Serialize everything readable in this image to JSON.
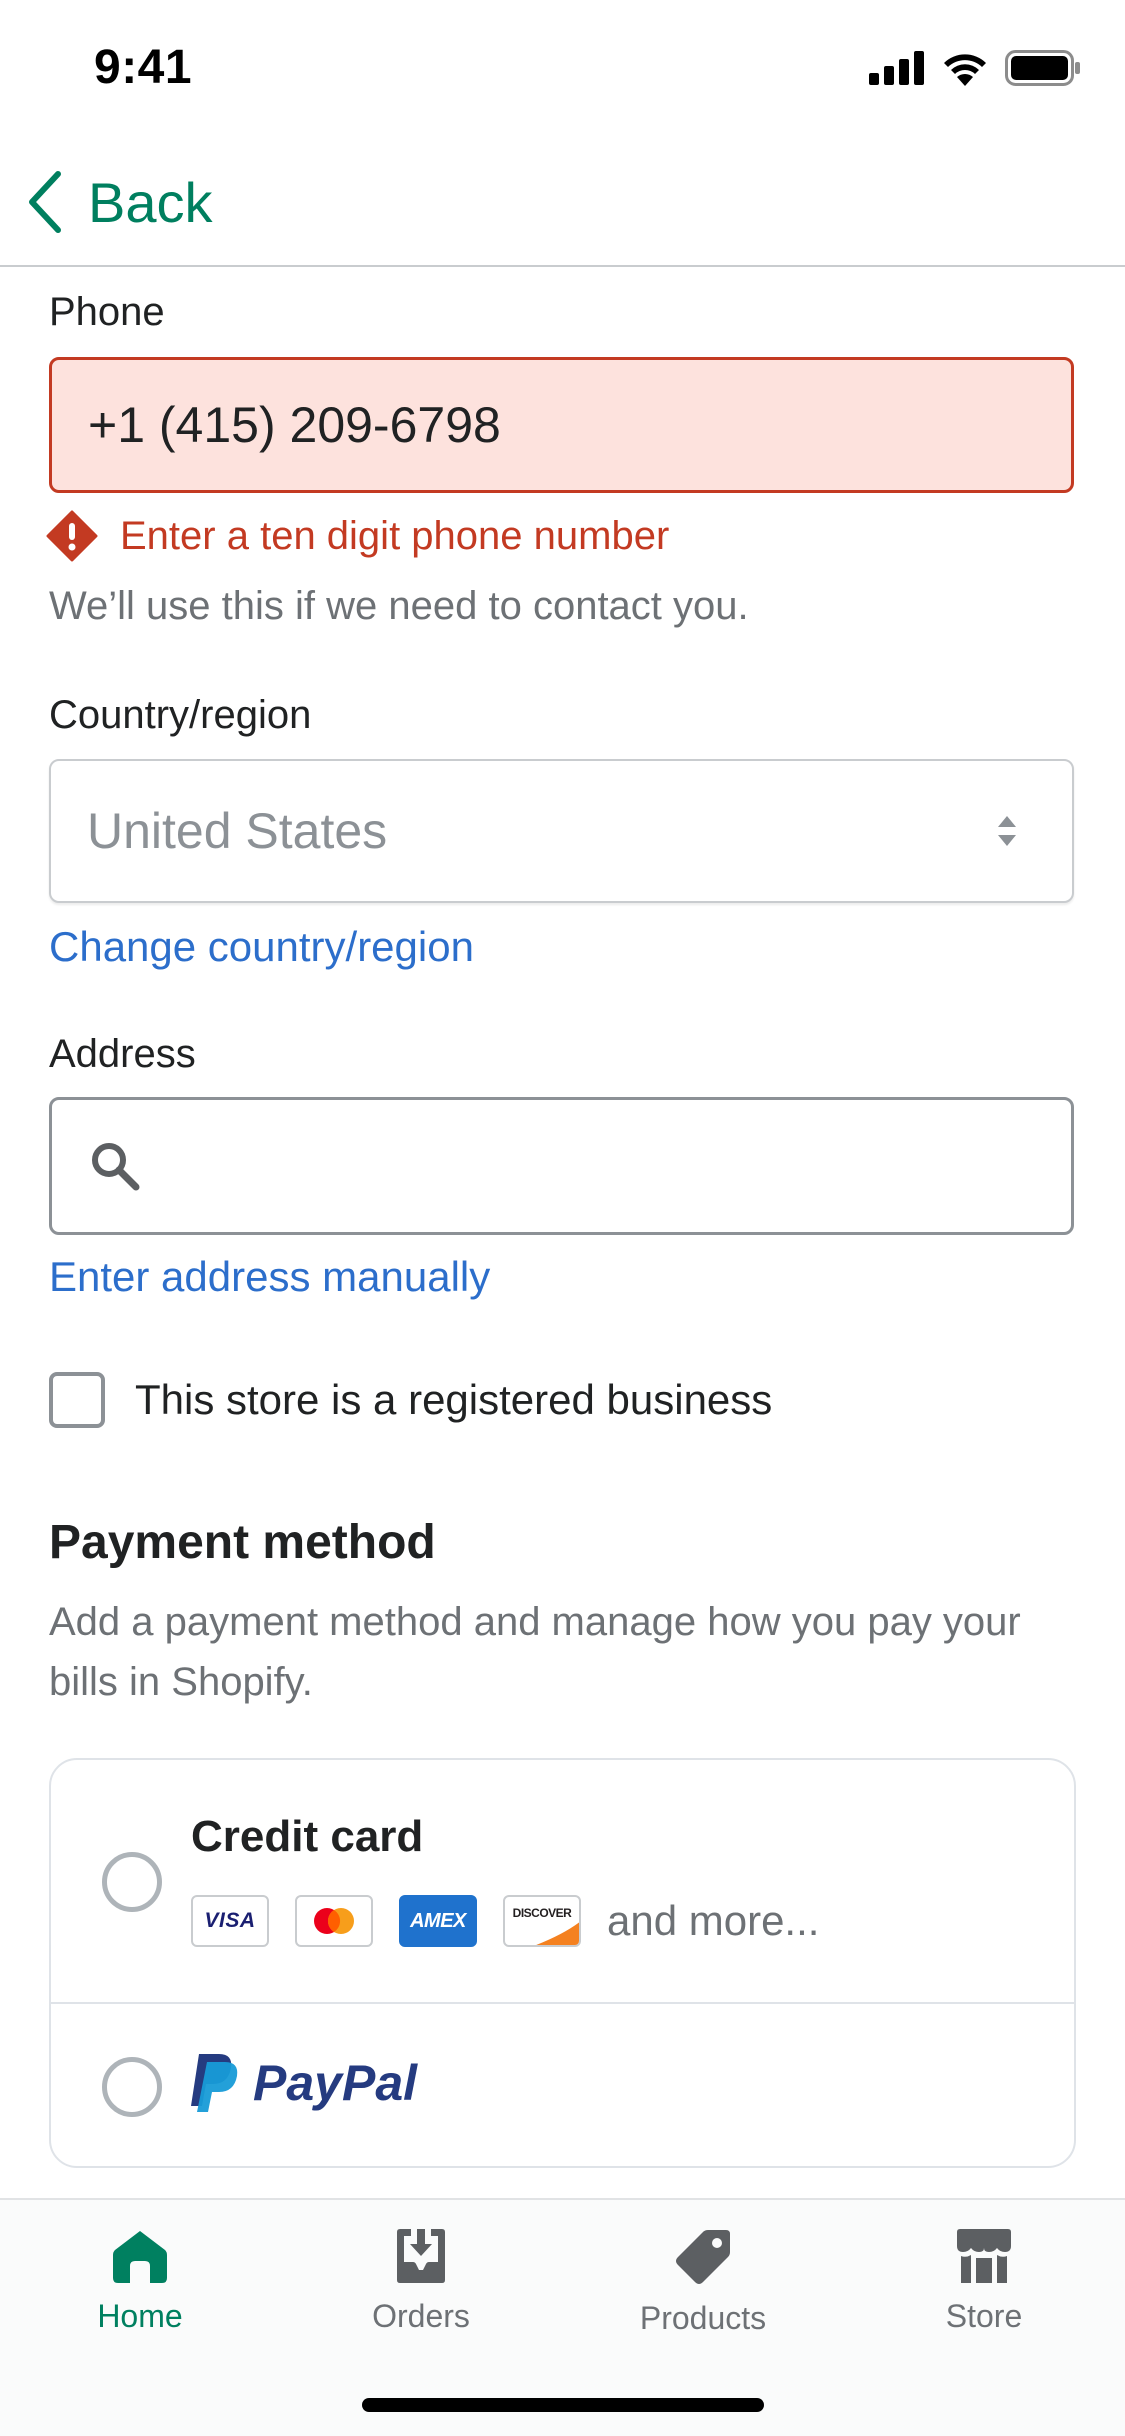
{
  "status_bar": {
    "time": "9:41"
  },
  "nav": {
    "back_label": "Back"
  },
  "phone": {
    "label": "Phone",
    "value": "+1 (415) 209-6798",
    "error": "Enter a ten digit phone number",
    "help": "We’ll use this if we need to contact you."
  },
  "country": {
    "label": "Country/region",
    "selected": "United States",
    "change_link": "Change country/region"
  },
  "address": {
    "label": "Address",
    "value": "",
    "manual_link": "Enter address manually"
  },
  "business": {
    "checkbox_label": "This store is a registered business",
    "checked": false
  },
  "payment": {
    "title": "Payment method",
    "description": "Add a payment method and manage how you pay your bills in Shopify.",
    "credit_card": {
      "title": "Credit card",
      "more": "and more...",
      "brand_logos": [
        "VISA",
        "mastercard",
        "AMEX",
        "DISCOVER"
      ]
    },
    "paypal": {
      "logo_text": "PayPal"
    }
  },
  "tabs": [
    {
      "label": "Home",
      "icon": "home-icon",
      "active": true
    },
    {
      "label": "Orders",
      "icon": "orders-icon",
      "active": false
    },
    {
      "label": "Products",
      "icon": "tag-icon",
      "active": false
    },
    {
      "label": "Store",
      "icon": "store-icon",
      "active": false
    }
  ],
  "colors": {
    "accent_green": "#008060",
    "link_blue": "#2c6ecb",
    "error_red": "#c33a22",
    "error_bg": "#fde2dd",
    "paypal_dark": "#253b80",
    "paypal_light": "#179bd7"
  }
}
